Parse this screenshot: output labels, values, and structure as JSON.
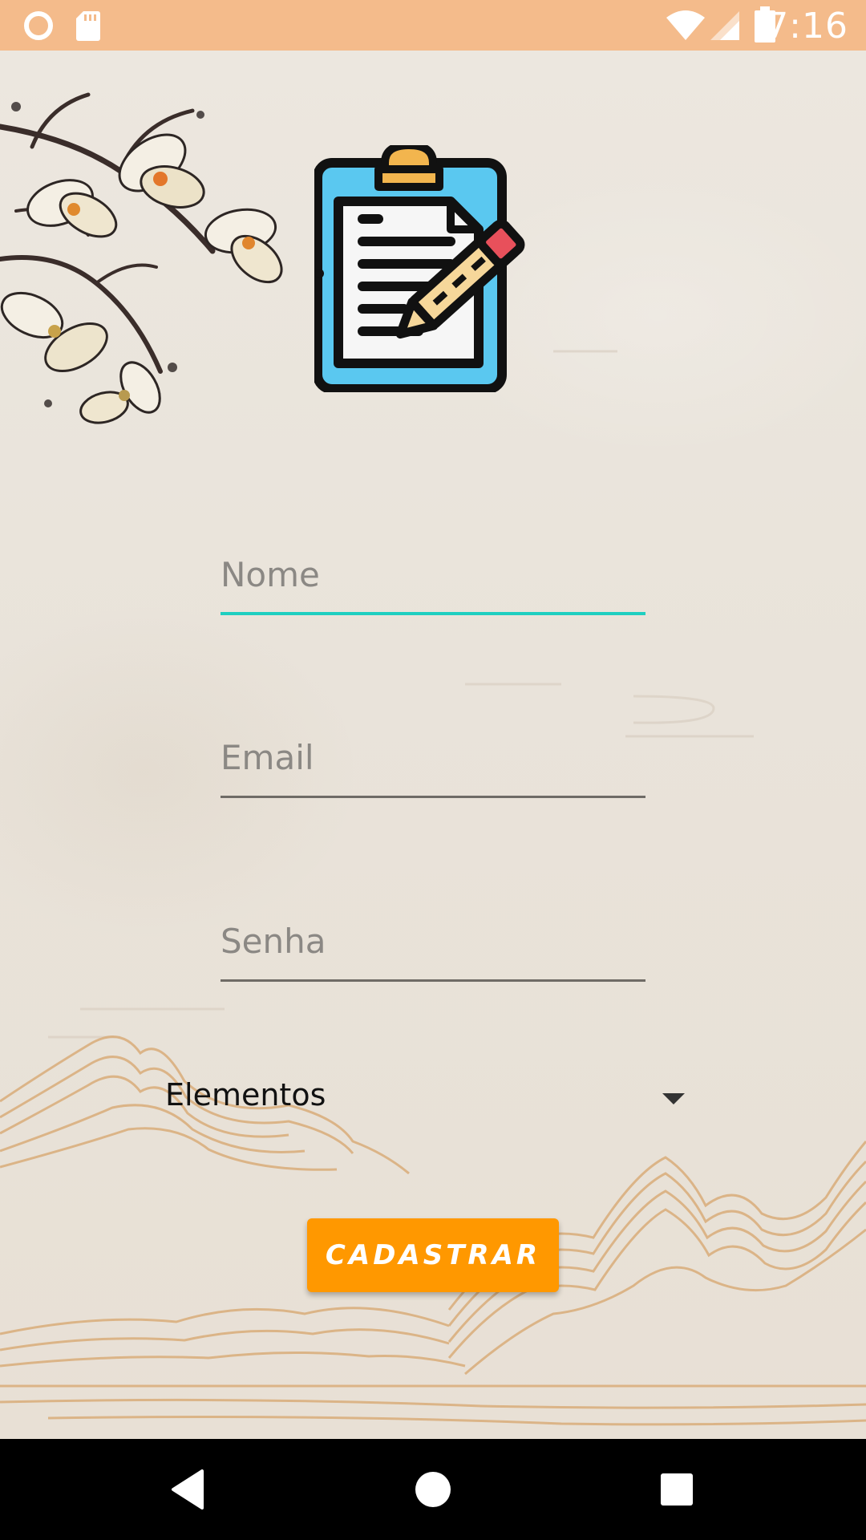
{
  "status_bar": {
    "time": "7:16",
    "icons": [
      "circle-notification-icon",
      "sd-card-icon",
      "wifi-icon",
      "signal-icon",
      "battery-icon"
    ]
  },
  "header": {
    "logo_icon": "clipboard-pencil-icon"
  },
  "form": {
    "name": {
      "placeholder": "Nome",
      "value": ""
    },
    "email": {
      "placeholder": "Email",
      "value": ""
    },
    "password": {
      "placeholder": "Senha",
      "value": ""
    },
    "element_select": {
      "selected": "Elementos"
    },
    "submit_label": "CADASTRAR"
  },
  "colors": {
    "status_bar": "#f4bb8b",
    "accent_focus": "#1fcfc0",
    "button": "#ff9800",
    "nav_bar": "#000000"
  },
  "nav_bar": {
    "buttons": [
      "back-icon",
      "home-icon",
      "recents-icon"
    ]
  }
}
